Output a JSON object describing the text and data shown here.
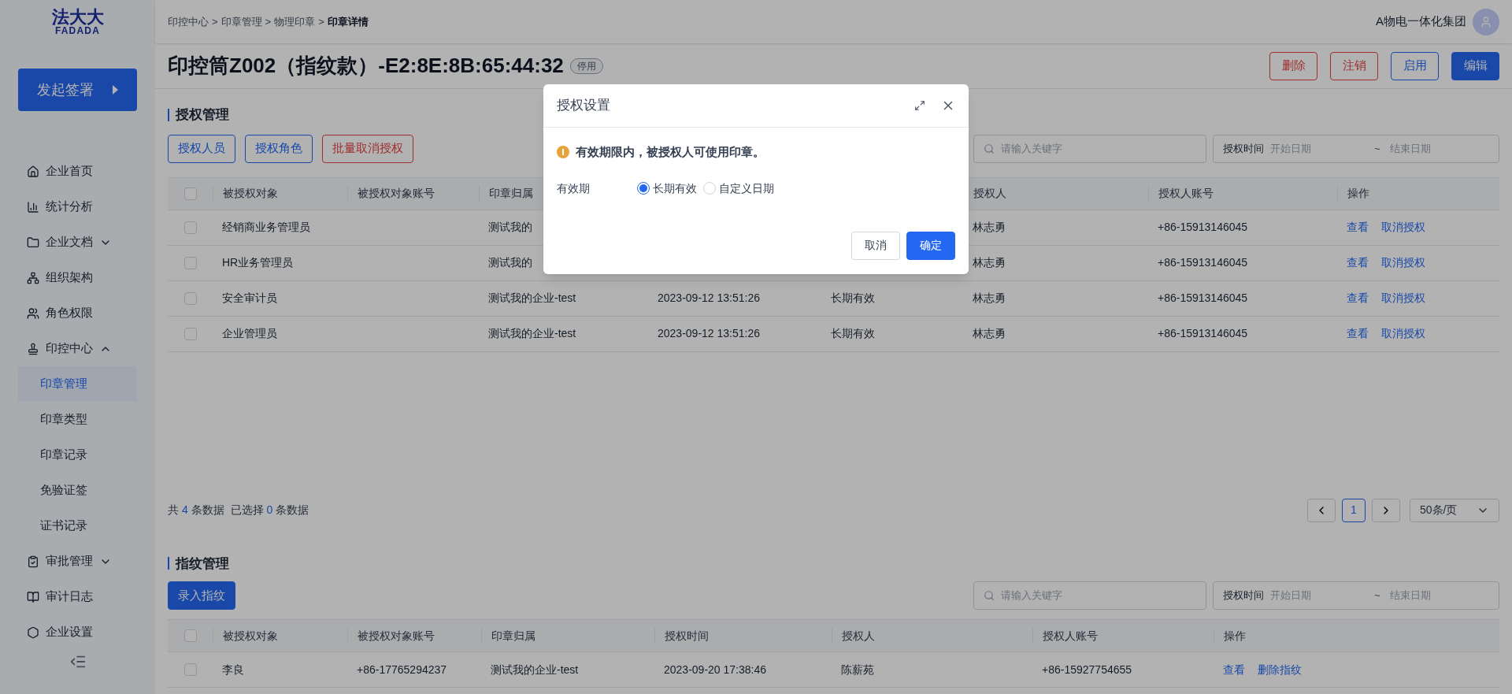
{
  "header": {
    "logo": {
      "top": "法大大",
      "bottom": "FADADA"
    },
    "breadcrumb": {
      "separator": ">",
      "items": [
        "印控中心",
        "印章管理",
        "物理印章",
        "印章详情"
      ]
    },
    "company": "A物电一体化集团"
  },
  "sidebar": {
    "action": "发起签署",
    "items": [
      {
        "label": "企业首页"
      },
      {
        "label": "统计分析"
      },
      {
        "label": "企业文档",
        "expanded": false
      },
      {
        "label": "组织架构"
      },
      {
        "label": "角色权限"
      },
      {
        "label": "印控中心",
        "expanded": true,
        "children": [
          {
            "label": "印章管理",
            "selected": true
          },
          {
            "label": "印章类型",
            "selected": false
          },
          {
            "label": "印章记录",
            "selected": false
          },
          {
            "label": "免验证签",
            "selected": false
          },
          {
            "label": "证书记录",
            "selected": false
          }
        ]
      },
      {
        "label": "审批管理",
        "expanded": false
      },
      {
        "label": "审计日志"
      },
      {
        "label": "企业设置"
      }
    ]
  },
  "title": {
    "text": "印控筒Z002（指纹款）-E2:8E:8B:65:44:32",
    "status": "停用"
  },
  "actions": [
    {
      "label": "删除",
      "kind": "danger"
    },
    {
      "label": "注销",
      "kind": "danger"
    },
    {
      "label": "启用",
      "kind": "outline"
    },
    {
      "label": "编辑",
      "kind": "primary"
    }
  ],
  "authorization": {
    "title": "授权管理",
    "buttons": [
      {
        "label": "授权人员",
        "kind": "outline"
      },
      {
        "label": "授权角色",
        "kind": "outline"
      },
      {
        "label": "批量取消授权",
        "kind": "danger"
      }
    ],
    "search": {
      "placeholder": "请输入关键字"
    },
    "date_range": {
      "label": "授权时间",
      "start_placeholder": "开始日期",
      "separator": "~",
      "end_placeholder": "结束日期"
    },
    "table": {
      "all_checked": false,
      "columns": [
        {
          "label": "被授权对象"
        },
        {
          "label": "被授权对象账号"
        },
        {
          "label": "印章归属"
        },
        {},
        {},
        {
          "label": "授权人"
        },
        {
          "label": "授权人账号"
        },
        {
          "label": "操作"
        }
      ],
      "rows": [
        {
          "checked": false,
          "cells": [
            "经销商业务管理员",
            null,
            "测试我的",
            null,
            null,
            "林志勇",
            "+86-15913146045"
          ],
          "links": [
            "查看",
            "取消授权"
          ]
        },
        {
          "checked": false,
          "cells": [
            "HR业务管理员",
            null,
            "测试我的",
            null,
            null,
            "林志勇",
            "+86-15913146045"
          ],
          "links": [
            "查看",
            "取消授权"
          ]
        },
        {
          "checked": false,
          "cells": [
            "安全审计员",
            null,
            "测试我的企业-test",
            "2023-09-12 13:51:26",
            "长期有效",
            "林志勇",
            "+86-15913146045"
          ],
          "links": [
            "查看",
            "取消授权"
          ]
        },
        {
          "checked": false,
          "cells": [
            "企业管理员",
            null,
            "测试我的企业-test",
            "2023-09-12 13:51:26",
            "长期有效",
            "林志勇",
            "+86-15913146045"
          ],
          "links": [
            "查看",
            "取消授权"
          ]
        }
      ]
    },
    "summary": [
      {
        "text": "共",
        "kind": "label"
      },
      {
        "text": "4",
        "kind": "count"
      },
      {
        "text": "条数据  已选择",
        "kind": "label"
      },
      {
        "text": "0",
        "kind": "count"
      },
      {
        "text": "条数据",
        "kind": "label"
      }
    ],
    "pagination": {
      "pages": [
        {
          "label": "1",
          "selected": true
        }
      ],
      "page_size": "50条/页"
    }
  },
  "fingerprint": {
    "title": "指纹管理",
    "buttons": [
      {
        "label": "录入指纹",
        "kind": "primary"
      }
    ],
    "search": {
      "placeholder": "请输入关键字"
    },
    "date_range": {
      "label": "授权时间",
      "start_placeholder": "开始日期",
      "separator": "~",
      "end_placeholder": "结束日期"
    },
    "table": {
      "all_checked": false,
      "columns": [
        {
          "label": "被授权对象"
        },
        {
          "label": "被授权对象账号"
        },
        {
          "label": "印章归属"
        },
        {
          "label": "授权时间"
        },
        {
          "label": "授权人"
        },
        {
          "label": "授权人账号"
        },
        {
          "label": "操作"
        }
      ],
      "rows": [
        {
          "checked": false,
          "cells": [
            "李良",
            "+86-17765294237",
            "测试我的企业-test",
            "2023-09-20 17:38:46",
            "陈薪苑",
            "+86-15927754655"
          ],
          "links": [
            "查看",
            "删除指纹"
          ]
        }
      ]
    }
  },
  "dialog": {
    "title": "授权设置",
    "notice": "有效期限内，被授权人可使用印章。",
    "field_label": "有效期",
    "options": [
      {
        "label": "长期有效",
        "selected": true
      },
      {
        "label": "自定义日期",
        "selected": false
      }
    ],
    "buttons": [
      {
        "label": "取消",
        "kind": "default"
      },
      {
        "label": "确定",
        "kind": "primary"
      }
    ]
  }
}
